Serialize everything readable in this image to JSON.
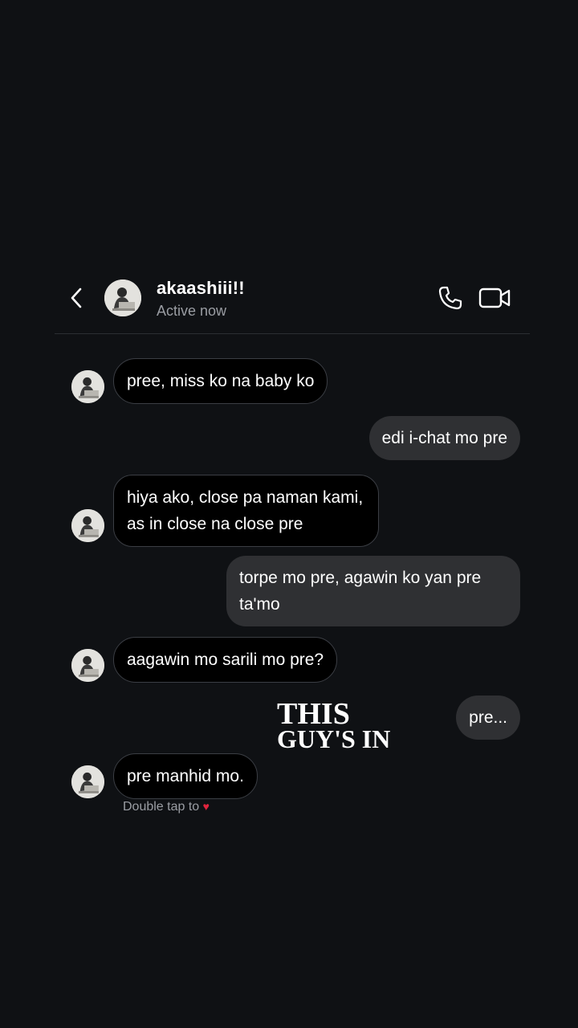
{
  "chat": {
    "contact_name": "akaashiii!!",
    "status": "Active now"
  },
  "messages": [
    {
      "side": "in",
      "text": "pree, miss ko na baby ko"
    },
    {
      "side": "out",
      "text": "edi i-chat mo pre"
    },
    {
      "side": "in",
      "text": "hiya ako, close pa naman kami, as in close na close pre"
    },
    {
      "side": "out",
      "text": "torpe mo pre, agawin ko yan pre ta'mo"
    },
    {
      "side": "in",
      "text": "aagawin mo sarili mo pre?"
    },
    {
      "side": "out",
      "text": "pre..."
    },
    {
      "side": "in",
      "text": "pre manhid mo."
    }
  ],
  "reaction_hint": {
    "text": "Double tap to",
    "heart": "♥"
  },
  "overlay": {
    "line1": "THIS",
    "line2": "GUY'S IN"
  },
  "icons": {
    "back": "chevron-left-icon",
    "call": "phone-icon",
    "video": "video-camera-icon"
  },
  "colors": {
    "background": "#0f1114",
    "incoming_bubble": "#000000",
    "outgoing_bubble": "#2f3033",
    "muted_text": "#9a9da3",
    "heart": "#e0243d"
  }
}
